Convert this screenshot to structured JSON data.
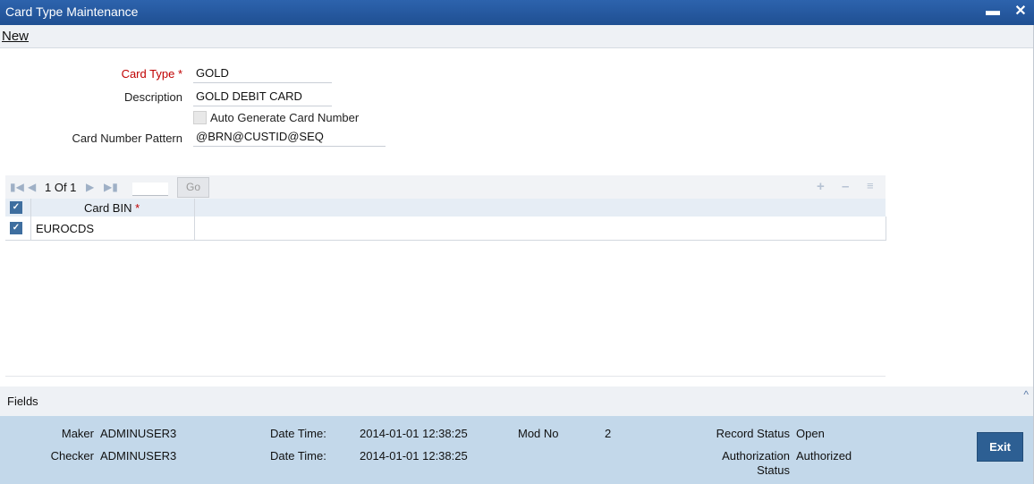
{
  "window": {
    "title": "Card Type Maintenance",
    "minimize_icon": "minimize-icon",
    "close_icon": "close-icon"
  },
  "menu": {
    "new_label": "New"
  },
  "form": {
    "card_type_label": "Card Type",
    "card_type_value": "GOLD",
    "description_label": "Description",
    "description_value": "GOLD DEBIT CARD",
    "auto_generate_label": "Auto Generate Card Number",
    "auto_generate_checked": false,
    "pattern_label": "Card Number Pattern",
    "pattern_value": "@BRN@CUSTID@SEQ",
    "required_marker": "*"
  },
  "grid": {
    "page_info": "1 Of 1",
    "go_label": "Go",
    "column_header": "Card BIN",
    "required_marker": "*",
    "rows": [
      {
        "card_bin": "EUROCDS"
      }
    ]
  },
  "fields_section": {
    "label": "Fields"
  },
  "audit": {
    "maker_label": "Maker",
    "maker_value": "ADMINUSER3",
    "checker_label": "Checker",
    "checker_value": "ADMINUSER3",
    "date_time_label": "Date Time:",
    "maker_date_time": "2014-01-01 12:38:25",
    "checker_date_time": "2014-01-01 12:38:25",
    "mod_no_label": "Mod No",
    "mod_no_value": "2",
    "record_status_label": "Record Status",
    "record_status_value": "Open",
    "auth_status_label_line1": "Authorization",
    "auth_status_label_line2": "Status",
    "auth_status_value": "Authorized",
    "exit_label": "Exit"
  },
  "colors": {
    "titlebar": "#2d63ad",
    "footer": "#c3d8ea",
    "required": "#c00000",
    "exit_button": "#2d5f93"
  }
}
